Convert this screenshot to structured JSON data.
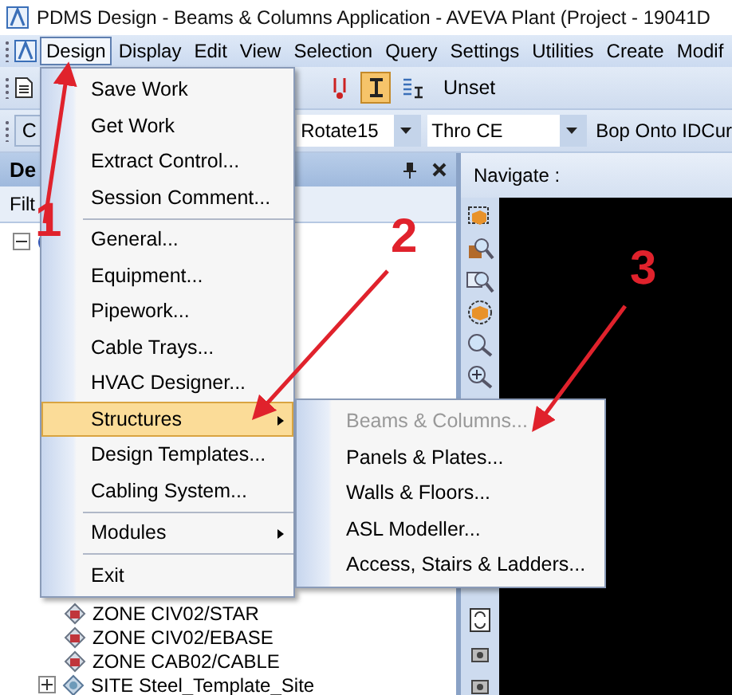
{
  "window": {
    "title": "PDMS Design - Beams & Columns Application -  AVEVA Plant (Project - 19041D"
  },
  "menubar": [
    {
      "label": "Design",
      "selected": true
    },
    {
      "label": "Display",
      "selected": false
    },
    {
      "label": "Edit",
      "selected": false
    },
    {
      "label": "View",
      "selected": false
    },
    {
      "label": "Selection",
      "selected": false
    },
    {
      "label": "Query",
      "selected": false
    },
    {
      "label": "Settings",
      "selected": false
    },
    {
      "label": "Utilities",
      "selected": false
    },
    {
      "label": "Create",
      "selected": false
    },
    {
      "label": "Modif",
      "selected": false
    }
  ],
  "toolbar_1": {
    "tools": [
      {
        "on": false
      },
      {
        "on": true
      },
      {
        "on": false
      }
    ],
    "label": "Unset"
  },
  "toolbar_2": {
    "button": "C",
    "combos": [
      "Rotate15",
      "Thro CE"
    ],
    "label": "Bop Onto IDCur"
  },
  "explorer": {
    "title": "De",
    "filter": "Filt",
    "tree": [
      {
        "expanded": true,
        "children": [
          {
            "children": [
              {
                "label": "ZONE CIV02/STAR"
              },
              {
                "label": "ZONE CIV02/EBASE"
              },
              {
                "label": "ZONE CAB02/CABLE"
              }
            ]
          },
          {
            "label": "SITE Steel_Template_Site",
            "expanded": false
          }
        ]
      }
    ]
  },
  "view": {
    "title": "Navigate :"
  },
  "design_menu": [
    {
      "kind": "item",
      "label": "Save Work",
      "selected": false
    },
    {
      "kind": "item",
      "label": "Get Work",
      "selected": false
    },
    {
      "kind": "item",
      "label": "Extract Control...",
      "selected": false
    },
    {
      "kind": "item",
      "label": "Session Comment...",
      "selected": false
    },
    {
      "kind": "separator"
    },
    {
      "kind": "item",
      "label": "General...",
      "selected": false
    },
    {
      "kind": "item",
      "label": "Equipment...",
      "selected": false
    },
    {
      "kind": "item",
      "label": "Pipework...",
      "selected": false
    },
    {
      "kind": "item",
      "label": "Cable Trays...",
      "selected": false
    },
    {
      "kind": "item",
      "label": "HVAC Designer...",
      "selected": false
    },
    {
      "kind": "submenu",
      "label": "Structures",
      "selected": true
    },
    {
      "kind": "item",
      "label": "Design Templates...",
      "selected": false
    },
    {
      "kind": "item",
      "label": "Cabling System...",
      "selected": false
    },
    {
      "kind": "separator"
    },
    {
      "kind": "submenu",
      "label": "Modules",
      "selected": false
    },
    {
      "kind": "separator"
    },
    {
      "kind": "item",
      "label": "Exit",
      "selected": false
    }
  ],
  "structures_menu": [
    {
      "label": "Beams & Columns...",
      "disabled": true
    },
    {
      "label": "Panels & Plates...",
      "disabled": false
    },
    {
      "label": "Walls & Floors...",
      "disabled": false
    },
    {
      "label": "ASL Modeller...",
      "disabled": false
    },
    {
      "label": "Access, Stairs & Ladders...",
      "disabled": false
    }
  ],
  "annotations": [
    {
      "label": "1"
    },
    {
      "label": "2"
    },
    {
      "label": "3"
    }
  ]
}
